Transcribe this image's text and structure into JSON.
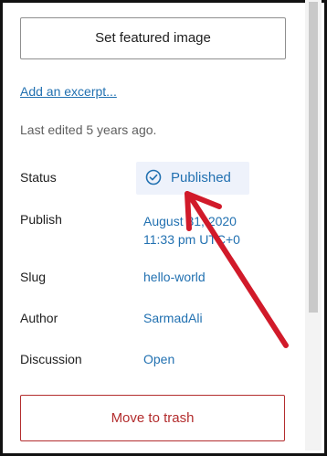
{
  "sidebar": {
    "featured_image_button": "Set featured image",
    "excerpt_link": "Add an excerpt...",
    "last_edited": "Last edited 5 years ago.",
    "status": {
      "label": "Status",
      "value": "Published"
    },
    "publish": {
      "label": "Publish",
      "value_line1": "August 31, 2020",
      "value_line2": "11:33 pm UTC+0"
    },
    "slug": {
      "label": "Slug",
      "value": "hello-world"
    },
    "author": {
      "label": "Author",
      "value": "SarmadAli"
    },
    "discussion": {
      "label": "Discussion",
      "value": "Open"
    },
    "trash_button": "Move to trash"
  },
  "icons": {
    "status": "check-circle-icon",
    "annotation": "red-arrow-annotation"
  },
  "colors": {
    "link": "#2271b1",
    "danger": "#b32d2e",
    "pill_bg": "#eef2fb",
    "annotation": "#d11a2a"
  }
}
